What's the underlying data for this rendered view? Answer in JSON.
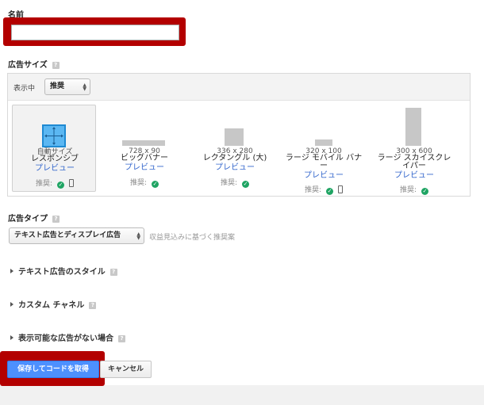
{
  "name_section": {
    "label": "名前",
    "input_value": ""
  },
  "ad_size": {
    "label": "広告サイズ",
    "help": "?",
    "display_label": "表示中",
    "display_select": "推奨",
    "cards": [
      {
        "dims": "",
        "name": "自動サイズ",
        "name2": "レスポンシブ",
        "preview": "プレビュー",
        "rec": "推奨:",
        "phone": true
      },
      {
        "dims": "728 x 90",
        "name": "ビッグバナー",
        "name2": "",
        "preview": "プレビュー",
        "rec": "推奨:",
        "phone": false
      },
      {
        "dims": "336 x 280",
        "name": "レクタングル (大)",
        "name2": "",
        "preview": "プレビュー",
        "rec": "推奨:",
        "phone": false
      },
      {
        "dims": "320 x 100",
        "name": "ラージ モバイル バナ",
        "name2": "ー",
        "preview": "プレビュー",
        "rec": "推奨:",
        "phone": true
      },
      {
        "dims": "300 x 600",
        "name": "ラージ スカイスクレ",
        "name2": "イパー",
        "preview": "プレビュー",
        "rec": "推奨:",
        "phone": false
      }
    ]
  },
  "ad_type": {
    "label": "広告タイプ",
    "help": "?",
    "select_value": "テキスト広告とディスプレイ広告",
    "hint": "収益見込みに基づく推奨案"
  },
  "sections": {
    "text_style": "テキスト広告のスタイル",
    "custom_channel": "カスタム チャネル",
    "no_ads": "表示可能な広告がない場合"
  },
  "actions": {
    "save": "保存してコードを取得",
    "cancel": "キャンセル"
  },
  "colors": {
    "accent_blue": "#4d90fe",
    "highlight_red": "#b30000",
    "check_green": "#1fa463",
    "link_blue": "#3366cc"
  }
}
